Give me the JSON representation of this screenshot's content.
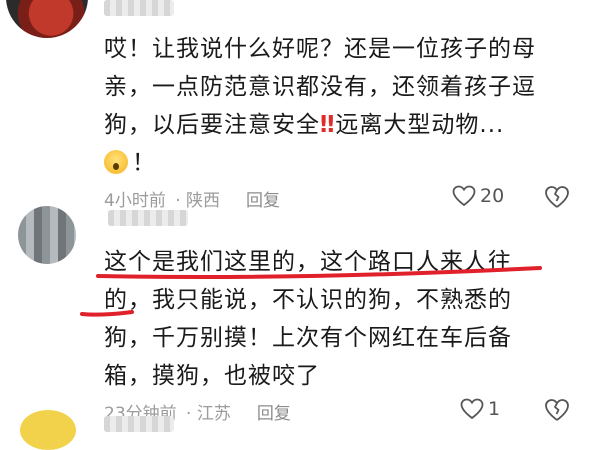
{
  "comments": [
    {
      "lines": [
        "哎！让我说什么好呢？还是一位孩子的母",
        "亲，一点防范意识都没有，还领着孩子逗",
        "狗，以后要注意安全",
        "远离大型动物...",
        "！"
      ],
      "meta": {
        "time": "4小时前",
        "sep": " · ",
        "location": "陕西",
        "reply": "回复"
      },
      "likes": "20"
    },
    {
      "lines": [
        "这个是我们这里的，这个路口人来人往",
        "的，我只能说，不认识的狗，不熟悉的",
        "狗，千万别摸！上次有个网红在车后备",
        "箱，摸狗，也被咬了"
      ],
      "meta": {
        "time": "23分钟前",
        "sep": " · ",
        "location": "江苏",
        "reply": "回复"
      },
      "likes": "1"
    }
  ],
  "emoji": {
    "double_exclamation": "‼",
    "face": "scared-face"
  },
  "colors": {
    "underline": "#e0202a",
    "meta": "#9b9b9b",
    "text": "#1a1a1a"
  }
}
